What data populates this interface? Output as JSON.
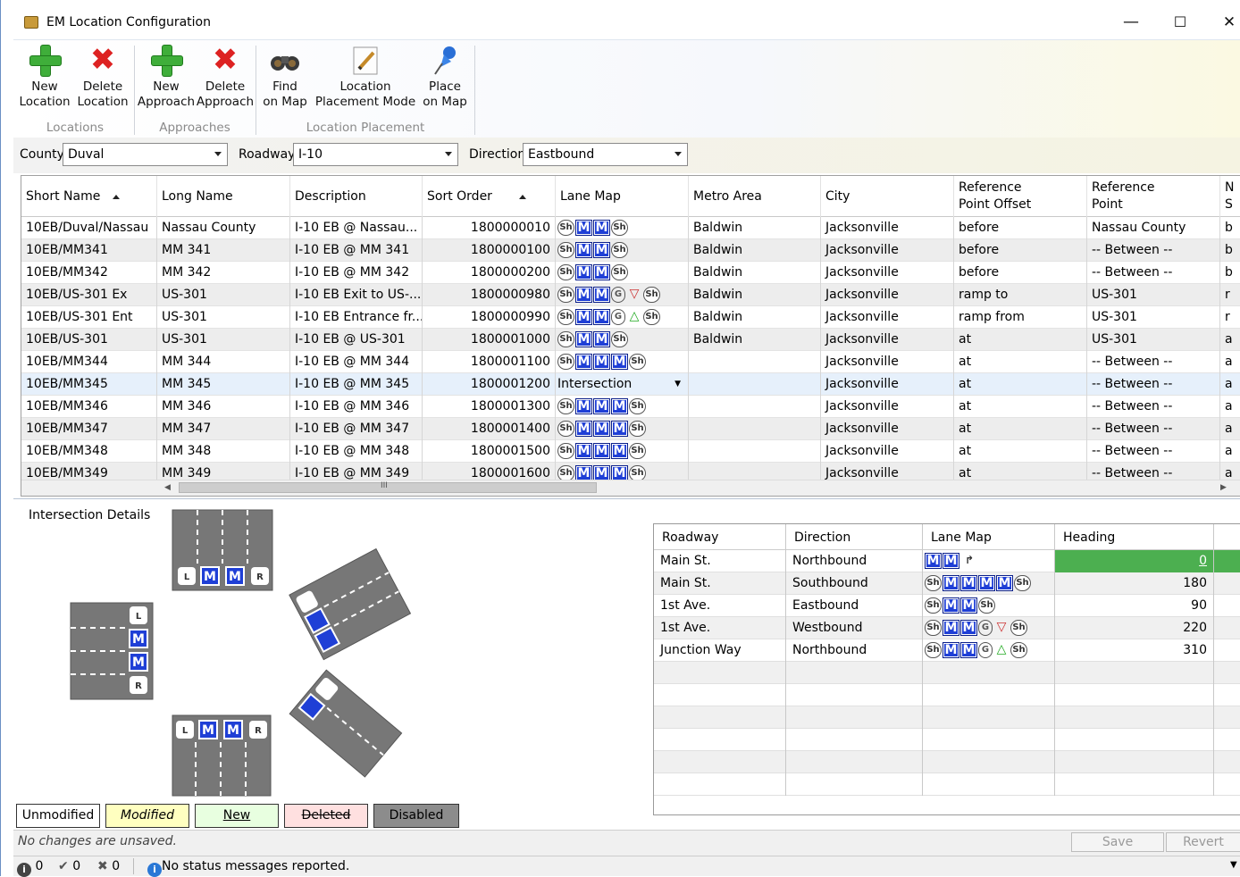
{
  "window": {
    "title": "EM Location Configuration",
    "min": "—",
    "max": "☐",
    "close": "✕"
  },
  "ribbon": {
    "buttons": [
      {
        "line1": "New",
        "line2": "Location"
      },
      {
        "line1": "Delete",
        "line2": "Location"
      },
      {
        "line1": "New",
        "line2": "Approach"
      },
      {
        "line1": "Delete",
        "line2": "Approach"
      },
      {
        "line1": "Find",
        "line2": "on Map"
      },
      {
        "line1": "Location",
        "line2": "Placement Mode"
      },
      {
        "line1": "Place",
        "line2": "on Map"
      }
    ],
    "groups": [
      "Locations",
      "Approaches",
      "Location Placement"
    ]
  },
  "filters": {
    "county_label": "County",
    "county_value": "Duval",
    "roadway_label": "Roadway",
    "roadway_value": "I-10",
    "direction_label": "Direction",
    "direction_value": "Eastbound"
  },
  "grid": {
    "columns": [
      "Short Name",
      "Long Name",
      "Description",
      "Sort Order",
      "Lane Map",
      "Metro Area",
      "City",
      "Reference",
      "Point Offset",
      "Reference",
      "Point",
      "N",
      "S"
    ],
    "rows": [
      {
        "short": "10EB/Duval/Nassau",
        "long": "Nassau County",
        "desc": "I-10 EB @ Nassau...",
        "sort": "1800000010",
        "lanes": "sh,m,m,sh",
        "metro": "Baldwin",
        "city": "Jacksonville",
        "offset": "before",
        "point": "Nassau County",
        "n": "b"
      },
      {
        "short": "10EB/MM341",
        "long": "MM 341",
        "desc": "I-10 EB @ MM 341",
        "sort": "1800000100",
        "lanes": "sh,m,m,sh",
        "metro": "Baldwin",
        "city": "Jacksonville",
        "offset": "before",
        "point": "-- Between --",
        "n": "b"
      },
      {
        "short": "10EB/MM342",
        "long": "MM 342",
        "desc": "I-10 EB @ MM 342",
        "sort": "1800000200",
        "lanes": "sh,m,m,sh",
        "metro": "Baldwin",
        "city": "Jacksonville",
        "offset": "before",
        "point": "-- Between --",
        "n": "b"
      },
      {
        "short": "10EB/US-301 Ex",
        "long": "US-301",
        "desc": "I-10 EB Exit to US-...",
        "sort": "1800000980",
        "lanes": "sh,m,m,g,off,sh",
        "metro": "Baldwin",
        "city": "Jacksonville",
        "offset": "ramp to",
        "point": "US-301",
        "n": "r"
      },
      {
        "short": "10EB/US-301 Ent",
        "long": "US-301",
        "desc": "I-10 EB Entrance fr...",
        "sort": "1800000990",
        "lanes": "sh,m,m,g,on,sh",
        "metro": "Baldwin",
        "city": "Jacksonville",
        "offset": "ramp from",
        "point": "US-301",
        "n": "r"
      },
      {
        "short": "10EB/US-301",
        "long": "US-301",
        "desc": "I-10 EB @ US-301",
        "sort": "1800001000",
        "lanes": "sh,m,m,sh",
        "metro": "Baldwin",
        "city": "Jacksonville",
        "offset": "at",
        "point": "US-301",
        "n": "a"
      },
      {
        "short": "10EB/MM344",
        "long": "MM 344",
        "desc": "I-10 EB @ MM 344",
        "sort": "1800001100",
        "lanes": "sh,m,m,m,sh",
        "metro": "",
        "city": "Jacksonville",
        "offset": "at",
        "point": "-- Between --",
        "n": "a"
      },
      {
        "short": "10EB/MM345",
        "long": "MM 345",
        "desc": "I-10 EB @ MM 345",
        "sort": "1800001200",
        "lanes": "",
        "lane_text": "Intersection",
        "metro": "",
        "city": "Jacksonville",
        "offset": "at",
        "point": "-- Between --",
        "n": "a"
      },
      {
        "short": "10EB/MM346",
        "long": "MM 346",
        "desc": "I-10 EB @ MM 346",
        "sort": "1800001300",
        "lanes": "sh,m,m,m,sh",
        "metro": "",
        "city": "Jacksonville",
        "offset": "at",
        "point": "-- Between --",
        "n": "a"
      },
      {
        "short": "10EB/MM347",
        "long": "MM 347",
        "desc": "I-10 EB @ MM 347",
        "sort": "1800001400",
        "lanes": "sh,m,m,m,sh",
        "metro": "",
        "city": "Jacksonville",
        "offset": "at",
        "point": "-- Between --",
        "n": "a"
      },
      {
        "short": "10EB/MM348",
        "long": "MM 348",
        "desc": "I-10 EB @ MM 348",
        "sort": "1800001500",
        "lanes": "sh,m,m,m,sh",
        "metro": "",
        "city": "Jacksonville",
        "offset": "at",
        "point": "-- Between --",
        "n": "a"
      },
      {
        "short": "10EB/MM349",
        "long": "MM 349",
        "desc": "I-10 EB @ MM 349",
        "sort": "1800001600",
        "lanes": "sh,m,m,m,sh",
        "metro": "",
        "city": "Jacksonville",
        "offset": "at",
        "point": "-- Between --",
        "n": "a"
      }
    ],
    "scroll_grip": "III"
  },
  "details": {
    "title": "Intersection Details",
    "columns": [
      "Roadway",
      "Direction",
      "Lane Map",
      "Heading"
    ],
    "rows": [
      {
        "road": "Main St.",
        "dir": "Northbound",
        "lanes": "m,m,r",
        "heading": "0"
      },
      {
        "road": "Main St.",
        "dir": "Southbound",
        "lanes": "sh,m,m,m,m,sh",
        "heading": "180"
      },
      {
        "road": "1st Ave.",
        "dir": "Eastbound",
        "lanes": "sh,m,m,sh",
        "heading": "90"
      },
      {
        "road": "1st Ave.",
        "dir": "Westbound",
        "lanes": "sh,m,m,g,off,sh",
        "heading": "220"
      },
      {
        "road": "Junction Way",
        "dir": "Northbound",
        "lanes": "sh,m,m,g,on,sh",
        "heading": "310"
      }
    ],
    "diagram_lane": "M",
    "diagram_left": "L",
    "diagram_right": "R"
  },
  "legend": [
    "Unmodified",
    "Modified",
    "New",
    "Deleted",
    "Disabled"
  ],
  "footer": {
    "status": "No changes are unsaved.",
    "save": "Save",
    "revert": "Revert"
  },
  "statusbar": {
    "info_count": "0",
    "ok_count": "0",
    "err_count": "0",
    "message": "No status messages reported."
  },
  "glyphs": {
    "sh": "Sh",
    "g": "G",
    "m": "M",
    "off": "▽",
    "on": "△",
    "r": "↱"
  },
  "colors": {
    "accent_green": "#4caf50",
    "lane_blue": "#1f3fd6",
    "modified": "#ffffc0",
    "new": "#e8ffe0",
    "deleted": "#ffe0e0",
    "disabled": "#8c8c8c"
  }
}
